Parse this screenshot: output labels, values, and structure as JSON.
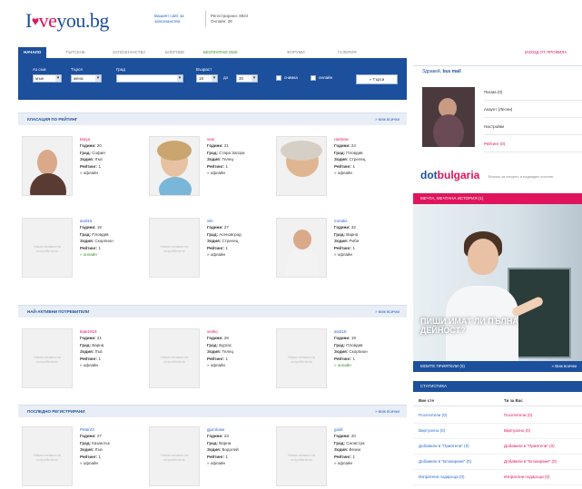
{
  "header": {
    "logo_pre": "I",
    "logo_heart": "♥",
    "logo_mid": "ve",
    "logo_post": "you.bg",
    "link": "Вашият сайт за запознанства",
    "stats_line1": "Регистрирани: 8924",
    "stats_line2": "Онлайн: 38"
  },
  "nav": {
    "tabs": [
      "Начало",
      "Търсене",
      "Запознанства",
      "Блогове",
      "Безплатни SMS",
      "Форуми",
      "Галерия"
    ],
    "active_tab": "Начало",
    "right_link": "Изход от профила"
  },
  "search": {
    "from_label": "Аз съм",
    "from_value": "мъж",
    "seek_label": "Търся",
    "seek_value": "жена",
    "city_label": "Град",
    "city_value": "",
    "age_label": "Възраст",
    "age_from": "18",
    "age_to_label": "до",
    "age_to": "30",
    "photo_label": "снимка",
    "online_label": "онлайн",
    "submit_label": "» Търси"
  },
  "sections": {
    "rating": {
      "title": "Класация по рейтинг",
      "more": "» виж всички"
    },
    "active": {
      "title": "Най-активни потребители",
      "more": "» виж всички"
    },
    "latest": {
      "title": "Последно регистрирани",
      "more": "» виж всички"
    }
  },
  "labels": {
    "years": "Години:",
    "city": "Град:",
    "zodiac": "Зодия:",
    "rating": "Рейтинг:",
    "no_photo": "Няма снимка на потребителя"
  },
  "rating_cards": [
    {
      "nick": "tanya",
      "years": "20",
      "city": "София",
      "zodiac": "Лъв",
      "rating": "1",
      "status": "» офлайн"
    },
    {
      "nick": "vesi",
      "years": "21",
      "city": "Стара Загора",
      "zodiac": "Телец",
      "rating": "1",
      "status": "» офлайн"
    },
    {
      "nick": "rainbow",
      "years": "24",
      "city": "Пловдив",
      "zodiac": "Стрелец",
      "rating": "1",
      "status": "» офлайн"
    },
    {
      "nick": "andi18",
      "years": "19",
      "city": "Пловдив",
      "zodiac": "Скорпион",
      "rating": "1",
      "status": "» онлайн"
    },
    {
      "nick": "viki",
      "years": "27",
      "city": "Асеновград",
      "zodiac": "Стрелец",
      "rating": "1",
      "status": "» офлайн"
    },
    {
      "nick": "mmaks",
      "years": "32",
      "city": "Варна",
      "zodiac": "Риби",
      "rating": "1",
      "status": "» офлайн"
    }
  ],
  "active_cards": [
    {
      "nick": "kate1919",
      "years": "21",
      "city": "Варна",
      "zodiac": "Лъв",
      "rating": "1",
      "status": "» офлайн"
    },
    {
      "nick": "vesko",
      "years": "26",
      "city": "Бургас",
      "zodiac": "Телец",
      "rating": "1",
      "status": "» офлайн"
    },
    {
      "nick": "andi18",
      "years": "19",
      "city": "Пловдив",
      "zodiac": "Скорпион",
      "rating": "1",
      "status": "» онлайн"
    }
  ],
  "latest_cards": [
    {
      "nick": "Petar23",
      "years": "27",
      "city": "Казанлък",
      "zodiac": "Лъв",
      "rating": "1",
      "status": "» офлайн"
    },
    {
      "nick": "gjuroloaw",
      "years": "23",
      "city": "Варна",
      "zodiac": "Водолей",
      "rating": "1",
      "status": "» офлайн"
    },
    {
      "nick": "goldi",
      "years": "20",
      "city": "Силистра",
      "zodiac": "Везни",
      "rating": "1",
      "status": "» офлайн"
    }
  ],
  "sidebar": {
    "hello": "Здравей,",
    "user": "bux mail",
    "menu": [
      "Писма (0)",
      "Акаунт (Лесни)",
      "Настройки",
      "Рейтинг (0)"
    ],
    "dot_pre": "dot",
    "dot_post": "bulgaria",
    "dot_text": "Всичко за сигурно и надеждно хостинг",
    "pink_bar": "Мечта, мечтана история (1)",
    "ad_text": "ПИШИ ИМАТ ЛИ ПЪЛНА ДЕЙНОСТ?",
    "blue_left": "Моите приятели (0)",
    "blue_right": "» Виж всички",
    "stats_title": "Статистика",
    "stats_col1": "Вие сте",
    "stats_col2": "Ти за Вас",
    "stats_rows": [
      [
        "Посетители (0)",
        "Посетители (0)"
      ],
      [
        "Виртуално (0)",
        "Виртуално (0)"
      ],
      [
        "Добавили в \"Приятели\" (0)",
        "Добавили в \"Приятели\" (0)"
      ],
      [
        "Добавили в \"Блокирани\" (0)",
        "Добавили в \"Блокирани\" (0)"
      ],
      [
        "Изпратени подаръци (0)",
        "Изпратени подаръци (0)"
      ]
    ]
  },
  "colors": {
    "brand_blue": "#1c4f9c",
    "brand_pink": "#e0145c",
    "online_green": "#3a8f2a"
  }
}
